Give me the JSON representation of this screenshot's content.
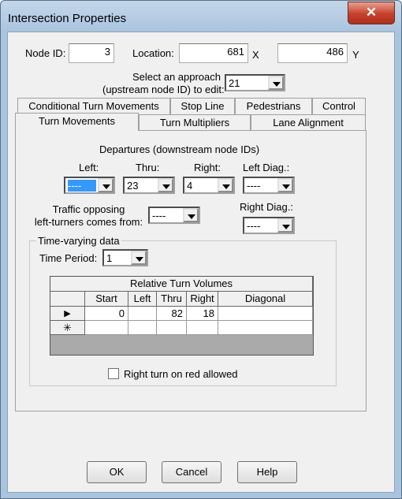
{
  "window": {
    "title": "Intersection Properties",
    "close_icon": "close-icon"
  },
  "node": {
    "label": "Node ID:",
    "value": "3"
  },
  "location": {
    "label": "Location:",
    "x": "681",
    "x_label": "X",
    "y": "486",
    "y_label": "Y"
  },
  "approach": {
    "label_line1": "Select an approach",
    "label_line2": "(upstream node ID) to edit:",
    "value": "21"
  },
  "tabs_row1": [
    "Conditional Turn Movements",
    "Stop Line",
    "Pedestrians",
    "Control"
  ],
  "tabs_row2": [
    "Turn Movements",
    "Turn Multipliers",
    "Lane Alignment"
  ],
  "active_tab": "Turn Movements",
  "departures": {
    "title": "Departures (downstream node IDs)",
    "left": {
      "label": "Left:",
      "value": "----"
    },
    "thru": {
      "label": "Thru:",
      "value": "23"
    },
    "right": {
      "label": "Right:",
      "value": "4"
    },
    "left_diag": {
      "label": "Left Diag.:",
      "value": "----"
    },
    "right_diag": {
      "label": "Right Diag.:",
      "value": "----"
    }
  },
  "opposing": {
    "label_line1": "Traffic opposing",
    "label_line2": "left-turners comes from:",
    "value": "----"
  },
  "time_varying": {
    "title": "Time-varying data",
    "period_label": "Time Period:",
    "period_value": "1",
    "grid": {
      "title": "Relative Turn Volumes",
      "columns": [
        "Start",
        "Left",
        "Thru",
        "Right",
        "Diagonal"
      ],
      "rows": [
        [
          "0",
          "",
          "82",
          "18",
          ""
        ]
      ],
      "current_row_marker": "▶",
      "new_row_marker": "✳"
    },
    "rtor": {
      "label": "Right turn on red allowed",
      "checked": false
    }
  },
  "buttons": {
    "ok": "OK",
    "cancel": "Cancel",
    "help": "Help"
  },
  "colors": {
    "selection": "#3399ff",
    "close": "#c4402a"
  }
}
